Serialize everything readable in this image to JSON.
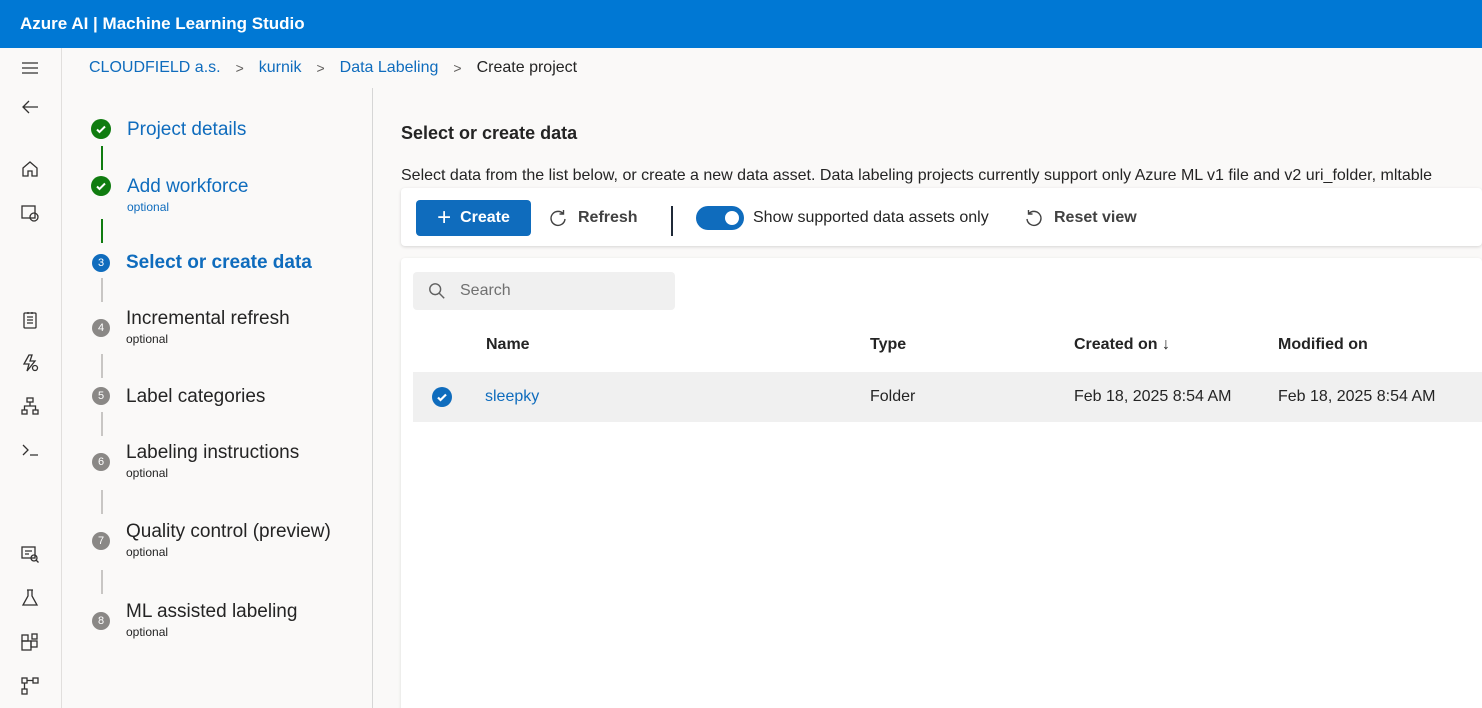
{
  "app": {
    "title": "Azure AI | Machine Learning Studio"
  },
  "breadcrumb": {
    "items": [
      "CLOUDFIELD a.s.",
      "kurnik",
      "Data Labeling"
    ],
    "current": "Create project"
  },
  "rail": {
    "icons": [
      "hamburger-menu-icon",
      "back-arrow-icon",
      "home-icon",
      "model-catalog-icon",
      "notebook-icon",
      "automl-icon",
      "designer-icon",
      "terminal-icon",
      "data-icon",
      "jobs-icon",
      "components-icon",
      "pipelines-icon"
    ]
  },
  "steps": [
    {
      "number": "1",
      "title": "Project details",
      "sub": "",
      "state": "done"
    },
    {
      "number": "2",
      "title": "Add workforce",
      "sub": "optional",
      "state": "done"
    },
    {
      "number": "3",
      "title": "Select or create data",
      "sub": "",
      "state": "current"
    },
    {
      "number": "4",
      "title": "Incremental refresh",
      "sub": "optional",
      "state": "todo"
    },
    {
      "number": "5",
      "title": "Label categories",
      "sub": "",
      "state": "todo"
    },
    {
      "number": "6",
      "title": "Labeling instructions",
      "sub": "optional",
      "state": "todo"
    },
    {
      "number": "7",
      "title": "Quality control (preview)",
      "sub": "optional",
      "state": "todo"
    },
    {
      "number": "8",
      "title": "ML assisted labeling",
      "sub": "optional",
      "state": "todo"
    }
  ],
  "main": {
    "heading": "Select or create data",
    "description": "Select data from the list below, or create a new data asset. Data labeling projects currently support only Azure ML v1 file and v2 uri_folder, mltable",
    "toolbar": {
      "create_label": "Create",
      "refresh_label": "Refresh",
      "toggle_label": "Show supported data assets only",
      "toggle_on": true,
      "reset_label": "Reset view"
    },
    "search": {
      "placeholder": "Search",
      "value": ""
    },
    "table": {
      "columns": [
        "Name",
        "Type",
        "Created on ↓",
        "Modified on"
      ],
      "rows": [
        {
          "selected": true,
          "name": "sleepky",
          "type": "Folder",
          "created": "Feb 18, 2025 8:54 AM",
          "modified": "Feb 18, 2025 8:54 AM"
        }
      ]
    }
  },
  "colors": {
    "brand": "#0078d4",
    "accent": "#0f6cbd",
    "done": "#107c10",
    "todo": "#8a8886"
  }
}
